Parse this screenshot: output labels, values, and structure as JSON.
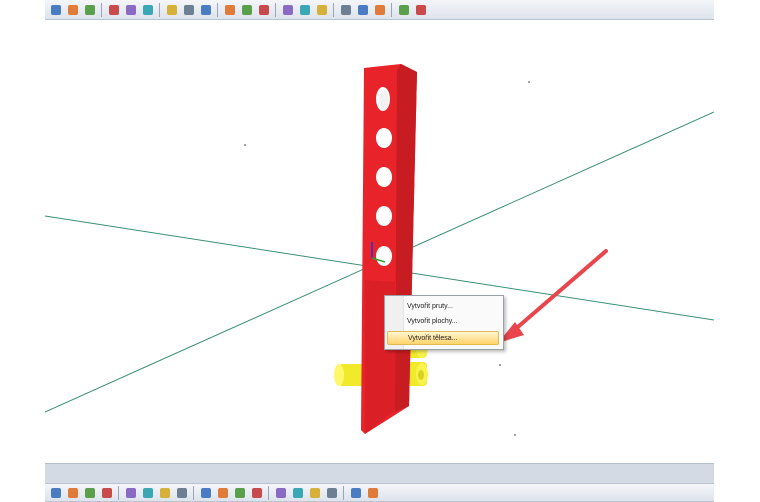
{
  "context_menu": {
    "items": [
      {
        "label": "Vytvořit pruty..."
      },
      {
        "label": "Vytvořit plochy..."
      },
      {
        "label": "Vytvořit tělesa..."
      }
    ],
    "highlighted_index": 2
  },
  "toolbar_top": {
    "icons": [
      "view-icon",
      "render-icon",
      "model-icon",
      "members-icon",
      "wizard-icon",
      "table-icon",
      "generate-icon",
      "node-icon",
      "line-icon",
      "surface-icon",
      "solid-icon",
      "support-icon",
      "hinge-icon",
      "load-icon",
      "mesh-icon",
      "select-icon",
      "zoom-icon",
      "rotate-icon",
      "display-icon",
      "result-icon"
    ]
  },
  "toolbar_bottom": {
    "icons": [
      "calendar-icon",
      "undo-icon",
      "redo-icon",
      "snap-icon",
      "grid-icon",
      "globe-icon",
      "frame-icon",
      "table-icon",
      "move-icon",
      "delete-icon",
      "cut-icon",
      "paste-icon",
      "layer-icon",
      "excel-icon",
      "report-icon",
      "formula-icon",
      "function-icon",
      "settings-icon"
    ]
  },
  "colors": {
    "part": "#e8232a",
    "cylinder": "#f4f02a",
    "axis_line": "#3a8f72",
    "arrow": "#e8454c",
    "highlight": "#ffd36b"
  }
}
